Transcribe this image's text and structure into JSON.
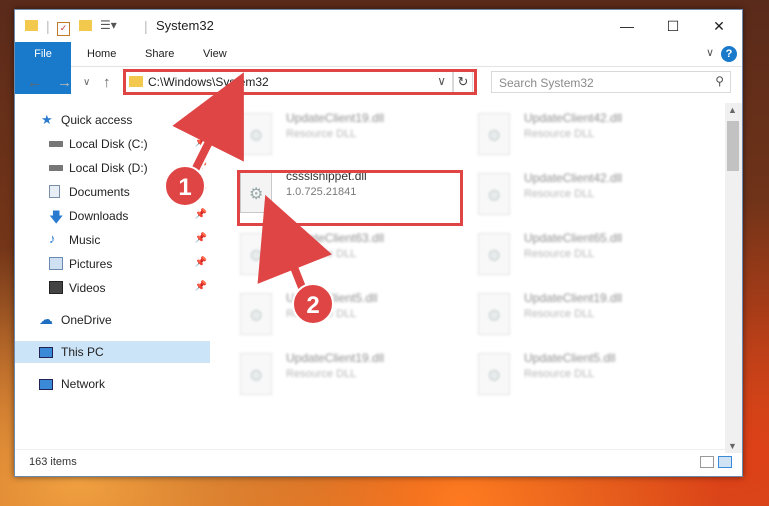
{
  "window": {
    "title": "System32",
    "minimize": "—",
    "maximize": "☐",
    "close": "✕"
  },
  "ribbon": {
    "tabs": [
      "File",
      "Home",
      "Share",
      "View"
    ],
    "help": "?",
    "expand": "∨"
  },
  "nav": {
    "back": "←",
    "forward": "→",
    "recent": "∨",
    "up": "↑",
    "path": "C:\\Windows\\System32",
    "dropdown": "∨",
    "refresh": "↻"
  },
  "search": {
    "placeholder": "Search System32",
    "icon": "search-icon"
  },
  "sidebar": {
    "items": [
      {
        "label": "Quick access",
        "icon": "star-icon",
        "pinned": false
      },
      {
        "label": "Local Disk (C:)",
        "icon": "drive-icon",
        "pinned": true
      },
      {
        "label": "Local Disk (D:)",
        "icon": "drive-icon",
        "pinned": true
      },
      {
        "label": "Documents",
        "icon": "documents-icon",
        "pinned": true
      },
      {
        "label": "Downloads",
        "icon": "download-icon",
        "pinned": true
      },
      {
        "label": "Music",
        "icon": "music-icon",
        "pinned": true
      },
      {
        "label": "Pictures",
        "icon": "pictures-icon",
        "pinned": true
      },
      {
        "label": "Videos",
        "icon": "videos-icon",
        "pinned": true
      },
      {
        "label": "OneDrive",
        "icon": "cloud-icon",
        "pinned": false
      },
      {
        "label": "This PC",
        "icon": "computer-icon",
        "pinned": false,
        "selected": true
      },
      {
        "label": "Network",
        "icon": "network-icon",
        "pinned": false
      }
    ]
  },
  "files": {
    "highlighted": {
      "name": "cssslsnippet.dll",
      "sub": "1.0.725.21841"
    },
    "left": [
      {
        "name": "UpdateClient19.dll",
        "sub": "Resource DLL"
      },
      {
        "name": "UpdateClient63.dll",
        "sub": "Resource DLL"
      },
      {
        "name": "UpdateClient5.dll",
        "sub": "Resource DLL"
      },
      {
        "name": "UpdateClient19.dll",
        "sub": "Resource DLL"
      }
    ],
    "right": [
      {
        "name": "UpdateClient42.dll",
        "sub": "Resource DLL"
      },
      {
        "name": "UpdateClient42.dll",
        "sub": "Resource DLL"
      },
      {
        "name": "UpdateClient65.dll",
        "sub": "Resource DLL"
      },
      {
        "name": "UpdateClient19.dll",
        "sub": "Resource DLL"
      },
      {
        "name": "UpdateClient5.dll",
        "sub": "Resource DLL"
      }
    ]
  },
  "status": {
    "count": "163 items"
  },
  "annotations": {
    "step1": "1",
    "step2": "2",
    "color": "#e04545"
  }
}
